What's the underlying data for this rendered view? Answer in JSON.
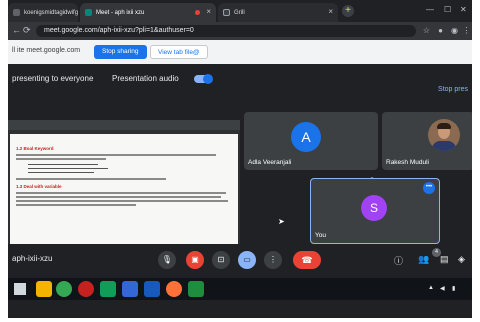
{
  "browser": {
    "tabs": [
      {
        "label": "koenigsmidtagidwifgj"
      },
      {
        "label": "Meet - aph ixii xzu"
      },
      {
        "label": "Grill"
      }
    ],
    "new_tab_icon": "plus-icon",
    "url": "meet.google.com/aph-ixii-xzu?pli=1&authuser=0"
  },
  "sharebar": {
    "message": "ll ite meet.google.com",
    "stop_label": "Stop sharing",
    "view_label": "View tab file@"
  },
  "meet": {
    "presenting_text": "presenting to everyone",
    "audio_label": "Presentation audio",
    "stop_link": "Stop pres",
    "slide": {
      "heading1": "1.2 Boal Keyword",
      "heading2": "1.3 Deal with variable"
    },
    "participants": [
      {
        "name": "Adla Veeranjali",
        "initial": "A",
        "color": "#1a73e8"
      },
      {
        "name": "Rakesh Muduli",
        "initial": "",
        "color": "#8a6b52"
      },
      {
        "name": "You",
        "initial": "S",
        "color": "#a142f4"
      }
    ],
    "meeting_code": "aph-ixii-xzu",
    "people_count": "4"
  },
  "colors": {
    "accent": "#1a73e8",
    "hangup": "#ea4335",
    "background": "#202124"
  }
}
